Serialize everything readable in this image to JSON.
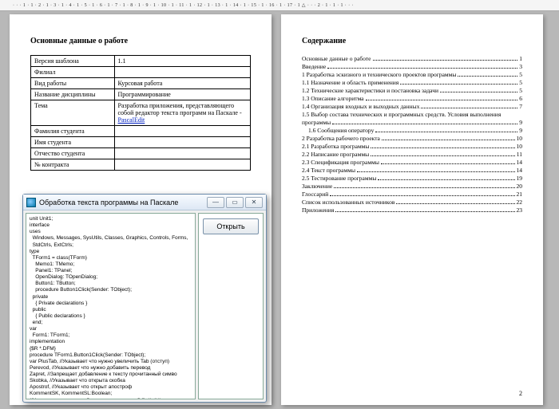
{
  "ruler": "· · · 1 · 1 · 2 · 1 · 3 · 1 · 4 · 1 · 5 · 1 · 6 · 1 · 7 · 1 · 8 · 1 · 9 · 1 · 10 · 1 · 11 · 1 · 12 · 1 · 13 · 1 · 14 · 1 · 15 · 1 · 16 · 1 · 17 · 1 △ · · · 2 · 1 · 1 · 1 · · ·",
  "page1": {
    "title": "Основные данные о работе",
    "rows": [
      {
        "k": "Версия шаблона",
        "v": "1.1"
      },
      {
        "k": "Филиал",
        "v": ""
      },
      {
        "k": "Вид работы",
        "v": "Курсовая работа"
      },
      {
        "k": "Название дисциплины",
        "v": "Программирование"
      },
      {
        "k": "Тема",
        "v": "Разработка приложения, представляющего собой редактор текста программ на Паскале - ",
        "link": "PascalEdit"
      },
      {
        "k": "Фамилия студента",
        "v": ""
      },
      {
        "k": "Имя студента",
        "v": ""
      },
      {
        "k": "Отчество студента",
        "v": ""
      },
      {
        "k": "№ контракта",
        "v": ""
      }
    ]
  },
  "page2": {
    "title": "Содержание",
    "toc": [
      {
        "t": "Основные данные о работе",
        "p": "1",
        "i": 0
      },
      {
        "t": "Введение",
        "p": "3",
        "i": 0
      },
      {
        "t": "1 Разработка эскизного и технического проектов программы",
        "p": "5",
        "i": 0
      },
      {
        "t": "1.1 Назначение и область применения",
        "p": "5",
        "i": 0
      },
      {
        "t": "1.2 Технические характеристики и постановка задачи",
        "p": "5",
        "i": 0
      },
      {
        "t": "1.3 Описание алгоритма",
        "p": "6",
        "i": 0
      },
      {
        "t": "1.4 Организация входных и выходных данных",
        "p": "7",
        "i": 0
      },
      {
        "t": "1.5 Выбор состава технических и программных средств. Условия выполнения",
        "p": "",
        "i": 0,
        "nodots": true
      },
      {
        "t": "программы",
        "p": "9",
        "i": 0
      },
      {
        "t": "1.6 Сообщения оператору",
        "p": "9",
        "i": 1
      },
      {
        "t": "2 Разработка рабочего проекта",
        "p": "10",
        "i": 0
      },
      {
        "t": "2.1 Разработка программы",
        "p": "10",
        "i": 0
      },
      {
        "t": "2.2 Написание программы",
        "p": "11",
        "i": 0
      },
      {
        "t": "2.3 Спецификация программы",
        "p": "14",
        "i": 0
      },
      {
        "t": "2.4 Текст программы",
        "p": "14",
        "i": 0
      },
      {
        "t": "2.5 Тестирование программы",
        "p": "19",
        "i": 0
      },
      {
        "t": "Заключение",
        "p": "20",
        "i": 0
      },
      {
        "t": "Глоссарий",
        "p": "21",
        "i": 0
      },
      {
        "t": "Список использованных источников",
        "p": "22",
        "i": 0
      },
      {
        "t": "Приложения",
        "p": "23",
        "i": 0
      }
    ],
    "pagenum": "2"
  },
  "window": {
    "title": "Обработка текста программы на Паскале",
    "open_label": "Открыть",
    "code": "unit Unit1;\ninterface\nuses\n  Windows, Messages, SysUtils, Classes, Graphics, Controls, Forms,\n  StdCtrls, ExtCtrls;\ntype\n  TForm1 = class(TForm)\n    Memo1: TMemo;\n    Panel1: TPanel;\n    OpenDialog: TOpenDialog;\n    Button1: TButton;\n    procedure Button1Click(Sender: TObject);\n  private\n    { Private declarations }\n  public\n    { Public declarations }\n  end;\nvar\n  Form1: TForm1;\nimplementation\n{$R *.DFM}\nprocedure TForm1.Button1Click(Sender: TObject);\nvar PlusTab, //Указывает что нужно увеличить Tab (отступ)\nPerevod, //Указывает что нужно добавить перевод\nZapret, //Запрещает добавление к тексту прочитанный симво\nSkobka, //Указывает что открыта скобка\nApostrof, //Указывает что открыт апостроф\nKommentSK, KommentSL:Boolean;\n//Указывают что текущий текст - комментарий {}, //, (**)\nSlovo, //Хранит слово\nTab, //Содержит пробелы - отступ\nNewText:string; //Новый текст программы\nPS, //Предыдущий прочитанный из файла символ\nS:Char; //Текущий прочитанный из файла символ"
  }
}
